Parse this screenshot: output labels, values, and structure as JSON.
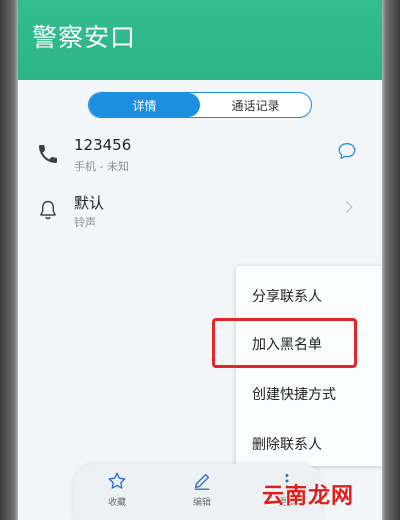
{
  "header": {
    "title": "警察安口",
    "color": "#2eb889"
  },
  "tabs": [
    {
      "label": "详情",
      "active": true
    },
    {
      "label": "通话记录",
      "active": false
    }
  ],
  "contact": {
    "phone": {
      "number": "123456",
      "detail": "手机 - 未知",
      "icon": "phone-icon",
      "action_icon": "message-icon"
    },
    "ringtone": {
      "value": "默认",
      "label": "铃声",
      "icon": "bell-icon",
      "action_icon": "chevron-right-icon"
    }
  },
  "menu": {
    "items": [
      {
        "label": "分享联系人"
      },
      {
        "label": "加入黑名单",
        "highlighted": true
      },
      {
        "label": "创建快捷方式"
      },
      {
        "label": "删除联系人"
      }
    ],
    "highlight_color": "#e52525"
  },
  "bottom_bar": {
    "items": [
      {
        "label": "收藏",
        "icon": "star-icon"
      },
      {
        "label": "编辑",
        "icon": "pencil-icon"
      },
      {
        "label": "更多",
        "icon": "more-icon"
      }
    ]
  },
  "watermark": {
    "text": "云南龙网",
    "color": "#e31b1b"
  },
  "accent_color": "#1e8fe0"
}
